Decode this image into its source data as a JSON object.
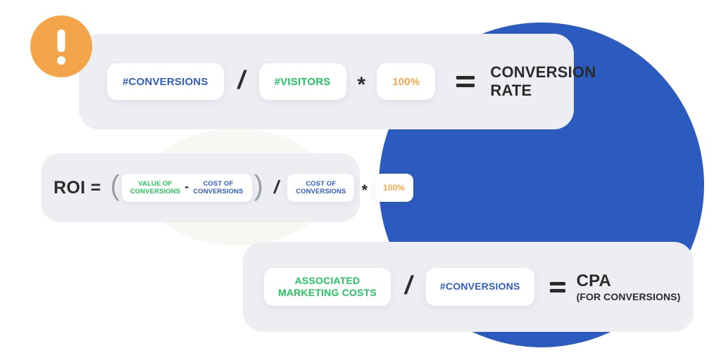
{
  "theme": {
    "background": "#FFFFFF",
    "panel": "#EDEEF2",
    "chip": "#FFFFFF",
    "accent_blue": "#2B5BBE",
    "text_blue": "#2F5CC4",
    "text_green": "#22C55E",
    "text_orange": "#F5A549",
    "text_dark": "#2B2B2B",
    "badge_orange": "#F5A549",
    "circle_cream": "#F8F7F3"
  },
  "badge": {
    "icon": "exclamation-icon",
    "symbol": "!"
  },
  "formulas": [
    {
      "id": "conversion-rate",
      "terms": {
        "numerator": "#CONVERSIONS",
        "denominator": "#VISITORS",
        "multiplier": "100%"
      },
      "operators": {
        "divide": "/",
        "multiply": "*",
        "equals": "="
      },
      "result": "CONVERSION\nRATE"
    },
    {
      "id": "roi",
      "label": "ROI =",
      "terms": {
        "open_paren": "(",
        "value_of_conversions": "VALUE OF\nCONVERSIONS",
        "minus": "-",
        "cost_of_conversions": "COST OF\nCONVERSIONS",
        "close_paren": ")",
        "divide": "/",
        "divisor": "COST OF\nCONVERSIONS",
        "multiply": "*",
        "multiplier": "100%"
      }
    },
    {
      "id": "cpa",
      "terms": {
        "numerator": "ASSOCIATED\nMARKETING COSTS",
        "denominator": "#CONVERSIONS"
      },
      "operators": {
        "divide": "/",
        "equals": "="
      },
      "result_main": "CPA",
      "result_sub": "(FOR CONVERSIONS)"
    }
  ]
}
